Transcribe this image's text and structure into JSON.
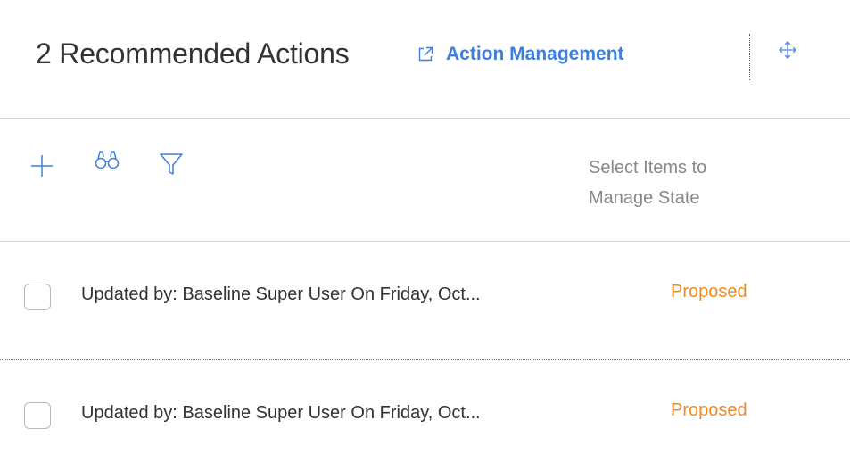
{
  "header": {
    "count": "2",
    "title": "2 Recommended Actions",
    "link_label": "Action Management",
    "link_icon": "external-link-icon",
    "move_icon": "move-arrows-icon"
  },
  "toolbar": {
    "add_icon": "plus-icon",
    "search_icon": "binoculars-icon",
    "filter_icon": "filter-funnel-icon",
    "manage_hint": "Select Items to Manage State"
  },
  "rows": [
    {
      "text": "Updated by: Baseline Super User On  Friday, Oct...",
      "state": "Proposed",
      "checked": false
    },
    {
      "text": "Updated by: Baseline Super User On  Friday, Oct...",
      "state": "Proposed",
      "checked": false
    }
  ],
  "colors": {
    "accent": "#3d7fe0",
    "state_proposed": "#f08b1d",
    "hint_text": "#888888"
  }
}
